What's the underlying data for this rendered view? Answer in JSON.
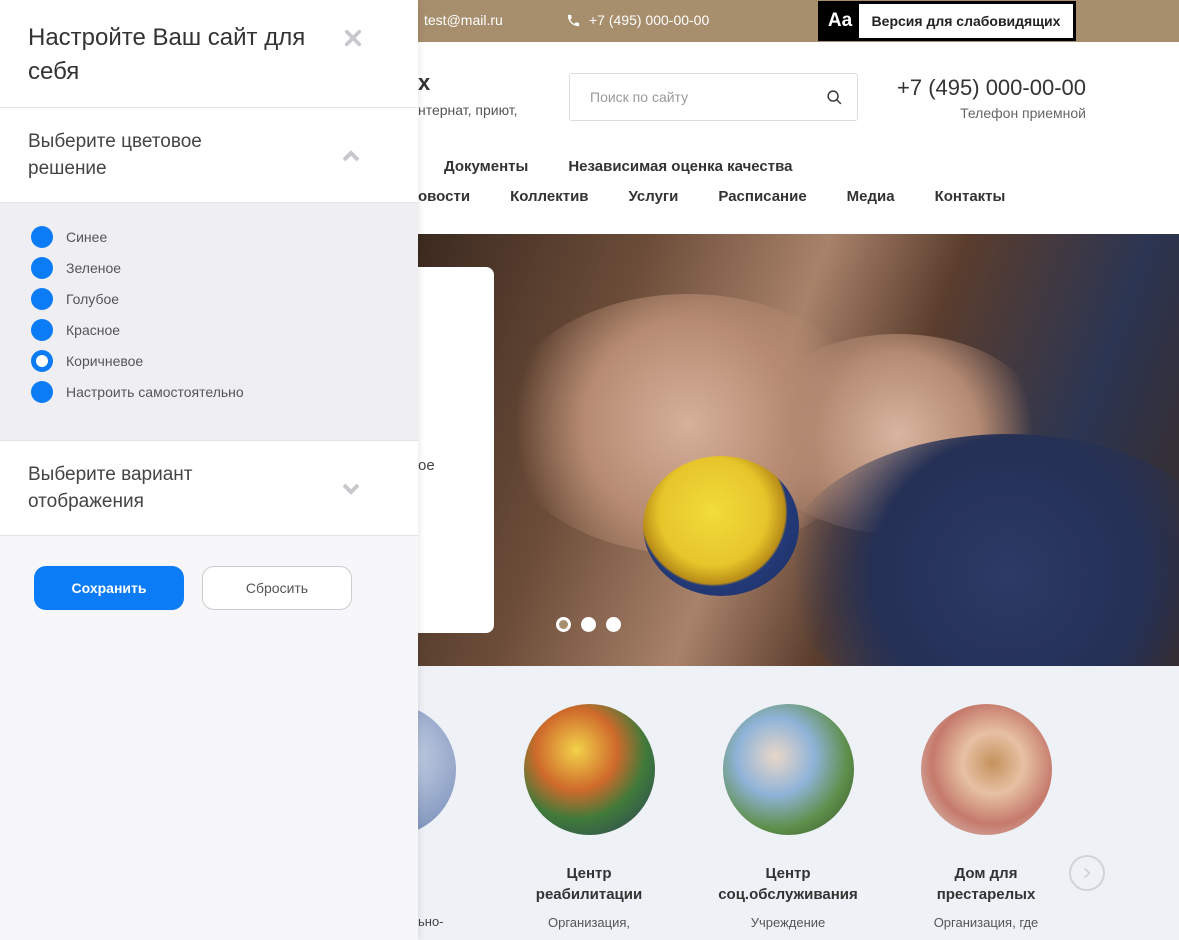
{
  "colors": {
    "accent_brown": "#a78e6d",
    "primary_blue": "#0b7cf5",
    "panel_bg": "#f7f7f9",
    "services_bg": "#eef1f6"
  },
  "topbar": {
    "email_partial": "test@mail.ru",
    "phone": "+7 (495) 000-00-00",
    "accessibility_icon": "Aa",
    "accessibility_label": "Версия для слабовидящих"
  },
  "header": {
    "logo_partial": "х",
    "logo_sub_partial": "нтернат, приют,",
    "search_placeholder": "Поиск по сайту",
    "phone": "+7 (495) 000-00-00",
    "phone_label": "Телефон приемной"
  },
  "nav": {
    "row1": [
      "Документы",
      "Независимая оценка качества"
    ],
    "row2": [
      "овости",
      "Коллектив",
      "Услуги",
      "Расписание",
      "Медиа",
      "Контакты"
    ]
  },
  "hero": {
    "card_text_partial": "ое",
    "slides_total": 3,
    "slide_active": 1
  },
  "services": {
    "partial_text": "ьно-",
    "items": [
      {
        "title_line1": "Центр",
        "title_line2": "реабилитации",
        "desc": "Организация,"
      },
      {
        "title_line1": "Центр",
        "title_line2": "соц.обслуживания",
        "desc": "Учреждение"
      },
      {
        "title_line1": "Дом для",
        "title_line2": "престарелых",
        "desc": "Организация, где"
      }
    ]
  },
  "panel": {
    "title": "Настройте Ваш сайт для себя",
    "color_section": {
      "title": "Выберите цветовое решение",
      "expanded": true,
      "options": [
        {
          "label": "Синее",
          "checked": false
        },
        {
          "label": "Зеленое",
          "checked": false
        },
        {
          "label": "Голубое",
          "checked": false
        },
        {
          "label": "Красное",
          "checked": false
        },
        {
          "label": "Коричневое",
          "checked": true
        },
        {
          "label": "Настроить самостоятельно",
          "checked": false
        }
      ]
    },
    "display_section": {
      "title": "Выберите вариант отображения",
      "expanded": false
    },
    "save_label": "Сохранить",
    "reset_label": "Сбросить"
  }
}
